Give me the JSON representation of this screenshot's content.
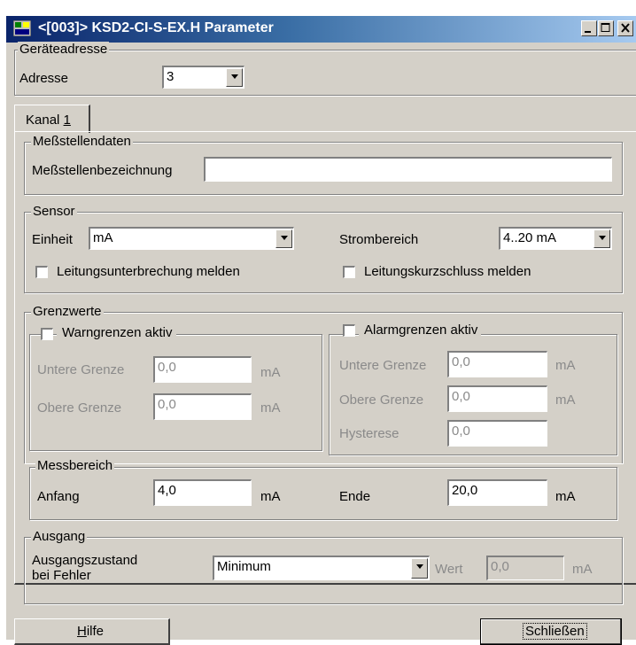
{
  "window": {
    "title": "<[003]> KSD2-CI-S-EX.H Parameter",
    "minimize_glyph": "_",
    "maximize_glyph": "□",
    "close_glyph": "×"
  },
  "address_group": {
    "legend": "Geräteadresse",
    "label": "Adresse",
    "value": "3"
  },
  "tabs": [
    {
      "label_prefix": "Kanal ",
      "label_mnemonic": "1",
      "selected": true
    }
  ],
  "measurement_point": {
    "legend": "Meßstellendaten",
    "label": "Meßstellenbezeichnung",
    "value": ""
  },
  "sensor": {
    "legend": "Sensor",
    "unit_label": "Einheit",
    "unit_value": "mA",
    "range_label": "Strombereich",
    "range_value": "4..20 mA",
    "wire_break_label": "Leitungsunterbrechung melden",
    "wire_break_checked": false,
    "short_circuit_label": "Leitungskurzschluss melden",
    "short_circuit_checked": false
  },
  "limits": {
    "legend": "Grenzwerte",
    "warning": {
      "label": "Warngrenzen aktiv",
      "checked": false,
      "lower_label": "Untere Grenze",
      "lower_value": "0,0",
      "lower_unit": "mA",
      "upper_label": "Obere Grenze",
      "upper_value": "0,0",
      "upper_unit": "mA"
    },
    "alarm": {
      "label": "Alarmgrenzen aktiv",
      "checked": false,
      "lower_label": "Untere Grenze",
      "lower_value": "0,0",
      "lower_unit": "mA",
      "upper_label": "Obere Grenze",
      "upper_value": "0,0",
      "upper_unit": "mA",
      "hysteresis_label": "Hysterese",
      "hysteresis_value": "0,0"
    }
  },
  "measuring_range": {
    "legend": "Messbereich",
    "start_label": "Anfang",
    "start_value": "4,0",
    "start_unit": "mA",
    "end_label": "Ende",
    "end_value": "20,0",
    "end_unit": "mA"
  },
  "output": {
    "legend": "Ausgang",
    "state_label_line1": "Ausgangszustand",
    "state_label_line2": "bei Fehler",
    "state_value": "Minimum",
    "value_label": "Wert",
    "value_value": "0,0",
    "value_unit": "mA"
  },
  "buttons": {
    "help_label": "Hilfe",
    "help_mnemonic": "H",
    "close_label": "Schließen"
  },
  "colors": {
    "title_gradient_start": "#0a246a",
    "title_gradient_end": "#a6caf0",
    "dialog_bg": "#d4d0c8",
    "disabled_text": "#8a8a8a"
  }
}
